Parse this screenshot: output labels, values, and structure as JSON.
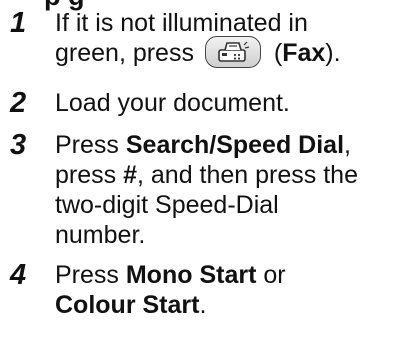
{
  "header": {
    "clipped_text": "p          g"
  },
  "steps": [
    {
      "number": "1",
      "line1": "If it is not illuminated in",
      "line2_pre": "green, press",
      "button_label": "Fax",
      "paren_open": "(",
      "paren_close": ")."
    },
    {
      "number": "2",
      "text": "Load your document."
    },
    {
      "number": "3",
      "pre": "Press ",
      "bold1": "Search/Speed Dial",
      "mid1": ",",
      "line2_pre": "press ",
      "bold2": "#",
      "line2_post": ", and then press the",
      "line3": "two-digit Speed-Dial",
      "line4": "number."
    },
    {
      "number": "4",
      "pre": "Press ",
      "bold1": "Mono Start",
      "mid": " or",
      "bold2": "Colour Start",
      "post": "."
    }
  ],
  "icons": {
    "fax": "fax-icon"
  }
}
